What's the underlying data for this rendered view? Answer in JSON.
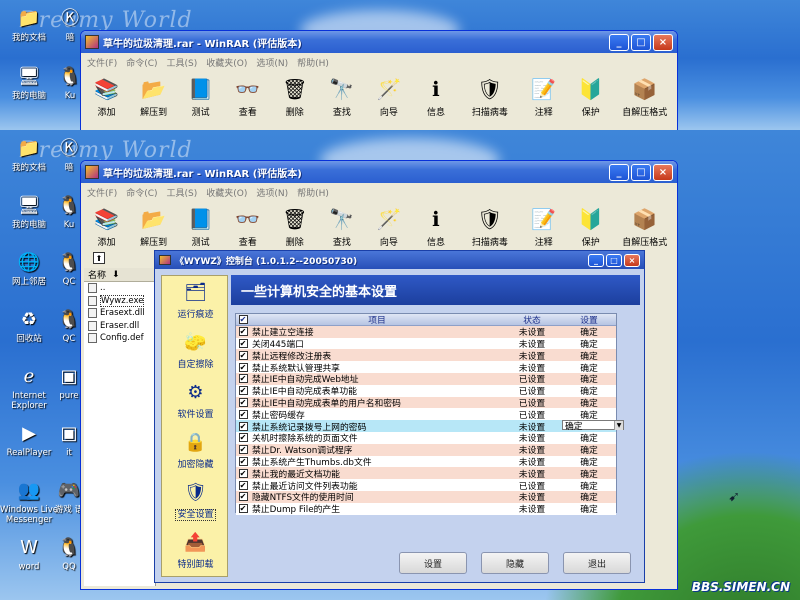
{
  "desktop": {
    "watermark": "Dreamy World",
    "site_watermark": "BBS.SIMEN.CN",
    "icons_top": [
      {
        "label": "我的文档",
        "icon": "folder-icon"
      },
      {
        "label": "我的电脑",
        "icon": "computer-icon"
      }
    ],
    "icons_top_col2": [
      {
        "label": "暗",
        "icon": "k-app-icon"
      },
      {
        "label": "Ku",
        "icon": "kugoo-icon"
      }
    ],
    "icons_bottom": [
      {
        "label": "我的文档",
        "icon": "folder-icon"
      },
      {
        "label": "我的电脑",
        "icon": "computer-icon"
      },
      {
        "label": "网上邻居",
        "icon": "network-icon"
      },
      {
        "label": "回收站",
        "icon": "recycle-bin-icon"
      },
      {
        "label": "Internet Explorer",
        "icon": "ie-icon"
      },
      {
        "label": "RealPlayer",
        "icon": "realplayer-icon"
      },
      {
        "label": "Windows Live Messenger",
        "icon": "messenger-icon"
      },
      {
        "label": "word",
        "icon": "word-icon"
      }
    ],
    "icons_bottom_col2": [
      {
        "label": "暗",
        "icon": "k-app-icon"
      },
      {
        "label": "Ku",
        "icon": "kugoo-icon"
      },
      {
        "label": "QC",
        "icon": "qq-icon"
      },
      {
        "label": "QC",
        "icon": "qq-icon"
      },
      {
        "label": "pure",
        "icon": "app-icon"
      },
      {
        "label": "it",
        "icon": "app-icon"
      },
      {
        "label": "游戏 语",
        "icon": "game-icon"
      },
      {
        "label": "QQ",
        "icon": "qq-icon"
      }
    ]
  },
  "winrar": {
    "title": "草牛的垃圾清理.rar - WinRAR (评估版本)",
    "menu": [
      "文件(F)",
      "命令(C)",
      "工具(S)",
      "收藏夹(O)",
      "选项(N)",
      "帮助(H)"
    ],
    "tools": [
      {
        "label": "添加",
        "icon": "add-archive-icon"
      },
      {
        "label": "解压到",
        "icon": "extract-icon"
      },
      {
        "label": "测试",
        "icon": "test-icon"
      },
      {
        "label": "查看",
        "icon": "view-icon"
      },
      {
        "label": "删除",
        "icon": "delete-icon"
      },
      {
        "label": "查找",
        "icon": "find-icon"
      },
      {
        "label": "向导",
        "icon": "wizard-icon"
      },
      {
        "label": "信息",
        "icon": "info-icon"
      },
      {
        "label": "扫描病毒",
        "icon": "scan-virus-icon"
      },
      {
        "label": "注释",
        "icon": "comment-icon"
      },
      {
        "label": "保护",
        "icon": "protect-icon"
      },
      {
        "label": "自解压格式",
        "icon": "sfx-icon"
      }
    ],
    "file_column_header": "名称",
    "files": [
      "..",
      "Wywz.exe",
      "Erasext.dll",
      "Eraser.dll",
      "Config.def"
    ]
  },
  "control_panel": {
    "title": "《WYWZ》控制台 (1.0.1.2--20050730)",
    "header": "一些计算机安全的基本设置",
    "sidebar": [
      {
        "label": "运行痕迹",
        "icon": "run-trace-icon"
      },
      {
        "label": "自定擦除",
        "icon": "custom-erase-icon"
      },
      {
        "label": "软件设置",
        "icon": "software-settings-icon"
      },
      {
        "label": "加密隐藏",
        "icon": "encrypt-hide-icon"
      },
      {
        "label": "安全设置",
        "icon": "security-settings-icon"
      },
      {
        "label": "特别卸载",
        "icon": "uninstall-icon"
      }
    ],
    "columns": {
      "item": "项目",
      "state": "状态",
      "setting": "设置"
    },
    "rows": [
      {
        "item": "禁止建立空连接",
        "state": "未设置",
        "setting": "确定"
      },
      {
        "item": "关闭445端口",
        "state": "未设置",
        "setting": "确定"
      },
      {
        "item": "禁止远程修改注册表",
        "state": "未设置",
        "setting": "确定"
      },
      {
        "item": "禁止系统默认管理共享",
        "state": "未设置",
        "setting": "确定"
      },
      {
        "item": "禁止IE中自动完成Web地址",
        "state": "已设置",
        "setting": "确定"
      },
      {
        "item": "禁止IE中自动完成表单功能",
        "state": "已设置",
        "setting": "确定"
      },
      {
        "item": "禁止IE中自动完成表单的用户名和密码",
        "state": "已设置",
        "setting": "确定"
      },
      {
        "item": "禁止密码缓存",
        "state": "已设置",
        "setting": "确定"
      },
      {
        "item": "禁止系统记录拨号上网的密码",
        "state": "未设置",
        "setting": "确定"
      },
      {
        "item": "关机时擦除系统的页面文件",
        "state": "未设置",
        "setting": "确定"
      },
      {
        "item": "禁止Dr. Watson调试程序",
        "state": "未设置",
        "setting": "确定"
      },
      {
        "item": "禁止系统产生Thumbs.db文件",
        "state": "未设置",
        "setting": "确定"
      },
      {
        "item": "禁止我的最近文档功能",
        "state": "未设置",
        "setting": "确定"
      },
      {
        "item": "禁止最近访问文件列表功能",
        "state": "已设置",
        "setting": "确定"
      },
      {
        "item": "隐藏NTFS文件的使用时间",
        "state": "未设置",
        "setting": "确定"
      },
      {
        "item": "禁止Dump File的产生",
        "state": "未设置",
        "setting": "确定"
      }
    ],
    "buttons": {
      "apply": "设置",
      "hide": "隐藏",
      "exit": "退出"
    }
  }
}
